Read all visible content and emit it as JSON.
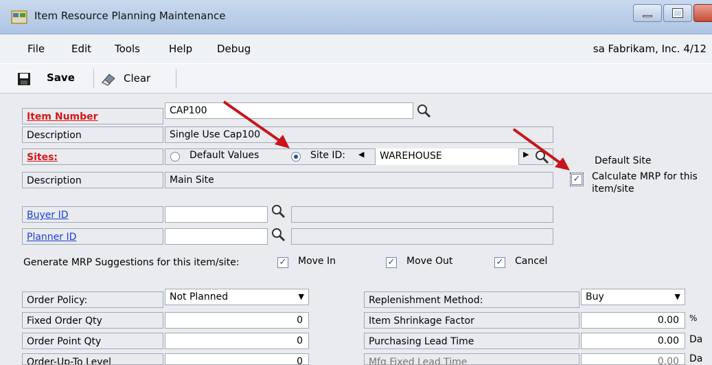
{
  "window": {
    "title": "Item Resource Planning Maintenance"
  },
  "menu": {
    "items": [
      "File",
      "Edit",
      "Tools",
      "Help",
      "Debug"
    ],
    "company": "sa  Fabrikam, Inc.  4/12"
  },
  "toolbar": {
    "save_label": "Save",
    "clear_label": "Clear"
  },
  "form": {
    "item_number_label": "Item Number",
    "item_number_value": "CAP100",
    "description_label": "Description",
    "description_value": "Single Use Cap100",
    "sites_label": "Sites:",
    "default_values_label": "Default Values",
    "site_id_label": "Site ID:",
    "site_id_value": "WAREHOUSE",
    "site_description_label": "Description",
    "site_description_value": "Main Site",
    "default_site_label": "Default Site",
    "calc_mrp_label_1": "Calculate MRP for this",
    "calc_mrp_label_2": "item/site",
    "buyer_id_label": "Buyer ID",
    "planner_id_label": "Planner ID",
    "generate_label": "Generate MRP Suggestions for this item/site:",
    "move_in_label": "Move In",
    "move_out_label": "Move Out",
    "cancel_label": "Cancel",
    "order_policy_label": "Order Policy:",
    "order_policy_value": "Not Planned",
    "fixed_order_qty_label": "Fixed Order Qty",
    "fixed_order_qty_value": "0",
    "order_point_qty_label": "Order Point Qty",
    "order_point_qty_value": "0",
    "order_up_to_label": "Order-Up-To Level",
    "order_up_to_value": "0",
    "replenishment_label": "Replenishment Method:",
    "replenishment_value": "Buy",
    "shrinkage_label": "Item Shrinkage Factor",
    "shrinkage_value": "0.00",
    "shrinkage_unit": "%",
    "purch_lead_label": "Purchasing Lead Time",
    "purch_lead_value": "0.00",
    "purch_lead_unit": "Da",
    "mfg_lead_label": "Mfg Fixed Lead Time",
    "mfg_lead_value": "0.00",
    "mfg_lead_unit": "Da"
  },
  "colors": {
    "required": "#d61818",
    "link": "#1a3fd6",
    "annotation_arrow": "#c8151b"
  }
}
